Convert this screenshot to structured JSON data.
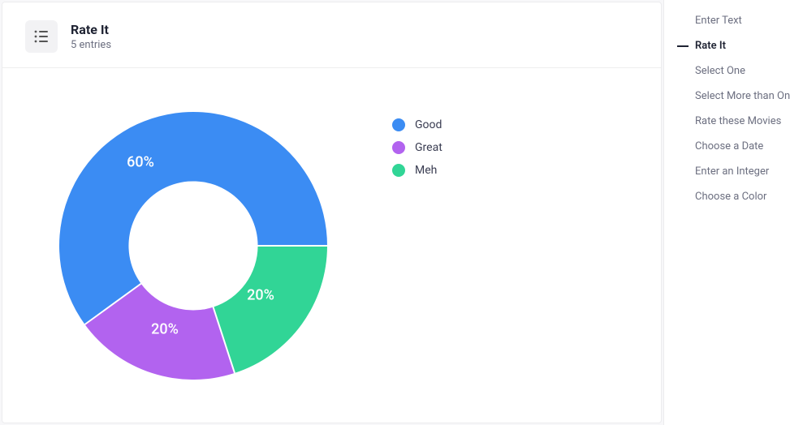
{
  "header": {
    "title": "Rate It",
    "subtitle": "5 entries"
  },
  "legend": [
    {
      "label": "Good",
      "color": "#3b8cf3"
    },
    {
      "label": "Great",
      "color": "#b263ef"
    },
    {
      "label": "Meh",
      "color": "#31d596"
    }
  ],
  "slice_labels": {
    "good": "60%",
    "great": "20%",
    "meh": "20%"
  },
  "sidebar": {
    "items": [
      {
        "label": "Enter Text",
        "active": false
      },
      {
        "label": "Rate It",
        "active": true
      },
      {
        "label": "Select One",
        "active": false
      },
      {
        "label": "Select More than One",
        "active": false
      },
      {
        "label": "Rate these Movies",
        "active": false
      },
      {
        "label": "Choose a Date",
        "active": false
      },
      {
        "label": "Enter an Integer",
        "active": false
      },
      {
        "label": "Choose a Color",
        "active": false
      }
    ]
  },
  "chart_data": {
    "type": "pie",
    "title": "Rate It",
    "categories": [
      "Good",
      "Great",
      "Meh"
    ],
    "values": [
      60,
      20,
      20
    ],
    "colors": [
      "#3b8cf3",
      "#b263ef",
      "#31d596"
    ],
    "donut": true,
    "start_angle_deg": 90,
    "direction": "clockwise"
  }
}
